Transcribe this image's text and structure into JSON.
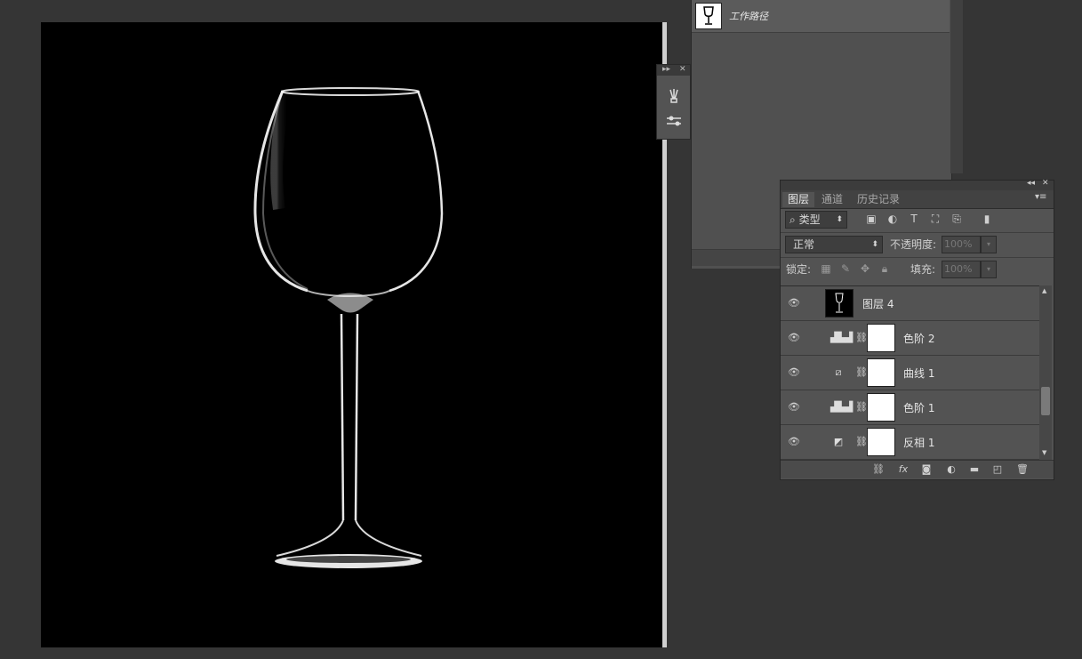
{
  "paths_panel": {
    "work_path_label": "工作路径"
  },
  "tool_strip": {
    "expand_glyph": "▸▸",
    "close_glyph": "✕",
    "tools": [
      "brush-preset-icon",
      "brush-settings-icon"
    ]
  },
  "layers_panel": {
    "collapse_glyph": "◂◂",
    "close_glyph": "✕",
    "menu_glyph": "▾≡",
    "tabs": [
      {
        "label": "图层",
        "active": true
      },
      {
        "label": "通道",
        "active": false
      },
      {
        "label": "历史记录",
        "active": false
      }
    ],
    "filter": {
      "kind_value": "类型",
      "icons": [
        "image-filter-icon",
        "adjustment-filter-icon",
        "type-filter-icon",
        "shape-filter-icon",
        "smart-object-filter-icon",
        "filter-toggle-icon"
      ]
    },
    "blend_mode": "正常",
    "opacity_label": "不透明度:",
    "opacity_value": "100%",
    "lock_label": "锁定:",
    "fill_label": "填充:",
    "fill_value": "100%",
    "layers": [
      {
        "name": "图层 4",
        "type": "pixel",
        "adj_icon": ""
      },
      {
        "name": "色阶 2",
        "type": "adjustment",
        "adj_icon": "levels-icon"
      },
      {
        "name": "曲线 1",
        "type": "adjustment",
        "adj_icon": "curves-icon"
      },
      {
        "name": "色阶 1",
        "type": "adjustment",
        "adj_icon": "levels-icon"
      },
      {
        "name": "反相 1",
        "type": "adjustment",
        "adj_icon": "invert-icon"
      }
    ],
    "footer_icons": [
      "link-layers-icon",
      "fx-icon",
      "add-mask-icon",
      "new-adjustment-icon",
      "new-group-icon",
      "new-layer-icon",
      "delete-icon"
    ]
  },
  "colors": {
    "workspace_bg": "#353535",
    "panel_bg": "#535353",
    "canvas_bg": "#000000"
  }
}
